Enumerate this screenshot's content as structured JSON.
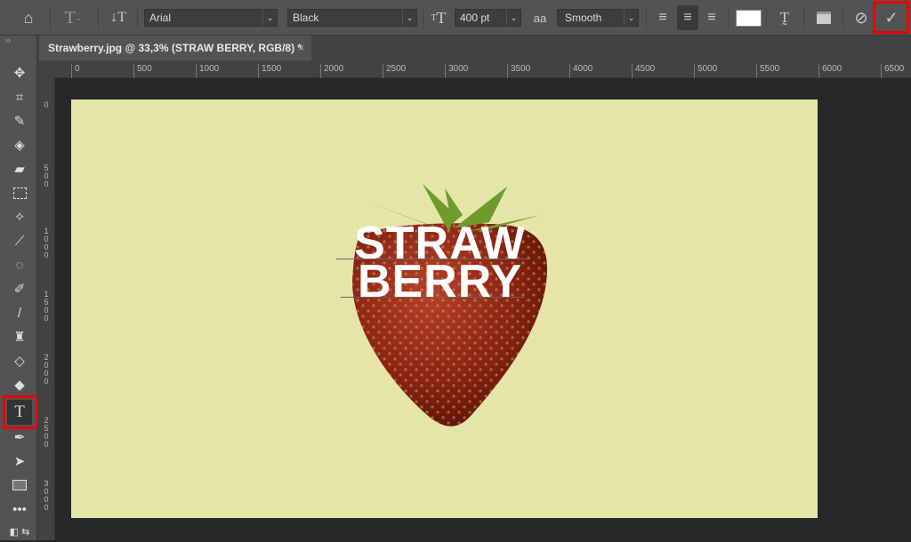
{
  "options_bar": {
    "font_family": "Arial",
    "font_style": "Black",
    "font_size": "400 pt",
    "antialias": "Smooth",
    "antialias_icon": "aa",
    "text_color": "#ffffff",
    "active_align": "center"
  },
  "document_tab": {
    "title": "Strawberry.jpg @ 33,3% (STRAW BERRY, RGB/8) *",
    "close": "×"
  },
  "panel_toggle": "››",
  "rulers": {
    "horizontal": [
      "0",
      "500",
      "1000",
      "1500",
      "2000",
      "2500",
      "3000",
      "3500",
      "4000",
      "4500",
      "5000",
      "5500",
      "6000",
      "6500"
    ],
    "vertical": [
      "0",
      "500",
      "1000",
      "1500",
      "2000",
      "2500",
      "3000"
    ]
  },
  "canvas": {
    "background": "#e6e5a8",
    "text_lines": [
      "STRAW",
      "BERRY"
    ]
  },
  "active_tool": "type-tool",
  "highlight_color": "#ee0000"
}
